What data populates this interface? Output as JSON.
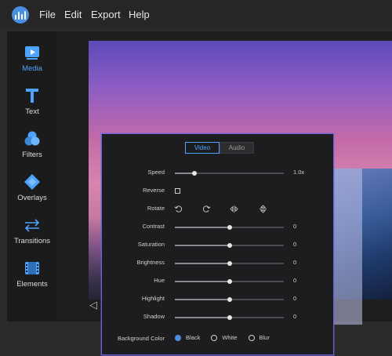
{
  "menubar": {
    "items": [
      "File",
      "Edit",
      "Export",
      "Help"
    ]
  },
  "sidebar": {
    "items": [
      {
        "label": "Media",
        "icon": "media-icon"
      },
      {
        "label": "Text",
        "icon": "text-icon"
      },
      {
        "label": "Filters",
        "icon": "filters-icon"
      },
      {
        "label": "Overlays",
        "icon": "overlays-icon"
      },
      {
        "label": "Transitions",
        "icon": "transitions-icon"
      },
      {
        "label": "Elements",
        "icon": "elements-icon"
      }
    ],
    "active_index": 0
  },
  "panel": {
    "tabs": [
      "Video",
      "Audio"
    ],
    "active_tab": "Video",
    "speed": {
      "label": "Speed",
      "value": "1.0x",
      "position": 0.18
    },
    "reverse": {
      "label": "Reverse",
      "checked": false
    },
    "rotate": {
      "label": "Rotate"
    },
    "sliders": [
      {
        "label": "Contrast",
        "value": "0",
        "position": 0.5
      },
      {
        "label": "Saturation",
        "value": "0",
        "position": 0.5
      },
      {
        "label": "Brightness",
        "value": "0",
        "position": 0.5
      },
      {
        "label": "Hue",
        "value": "0",
        "position": 0.5
      },
      {
        "label": "Highlight",
        "value": "0",
        "position": 0.5
      },
      {
        "label": "Shadow",
        "value": "0",
        "position": 0.5
      }
    ],
    "background_color": {
      "label": "Background Color",
      "options": [
        "Black",
        "White",
        "Blur"
      ],
      "selected": "Black"
    }
  },
  "colors": {
    "accent": "#4da3ff",
    "panel_border": "#6a64d8",
    "logo": "#4a90e2"
  }
}
